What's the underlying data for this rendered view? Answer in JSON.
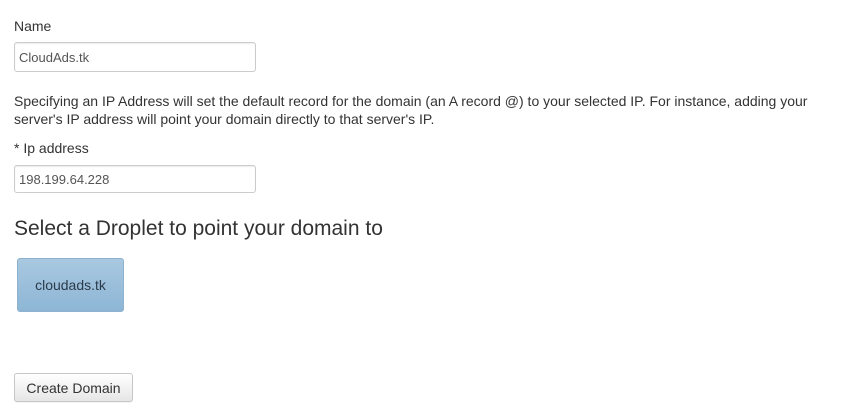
{
  "form": {
    "name_label": "Name",
    "name_value": "CloudAds.tk",
    "help_text": "Specifying an IP Address will set the default record for the domain (an A record @) to your selected IP. For instance, adding your server's IP address will point your domain directly to that server's IP.",
    "ip_label": "* Ip address",
    "ip_value": "198.199.64.228",
    "droplet_heading": "Select a Droplet to point your domain to",
    "droplets": [
      {
        "label": "cloudads.tk"
      }
    ],
    "submit_label": "Create Domain"
  },
  "colors": {
    "droplet_tile": "#8db6d6",
    "text": "#333333"
  }
}
